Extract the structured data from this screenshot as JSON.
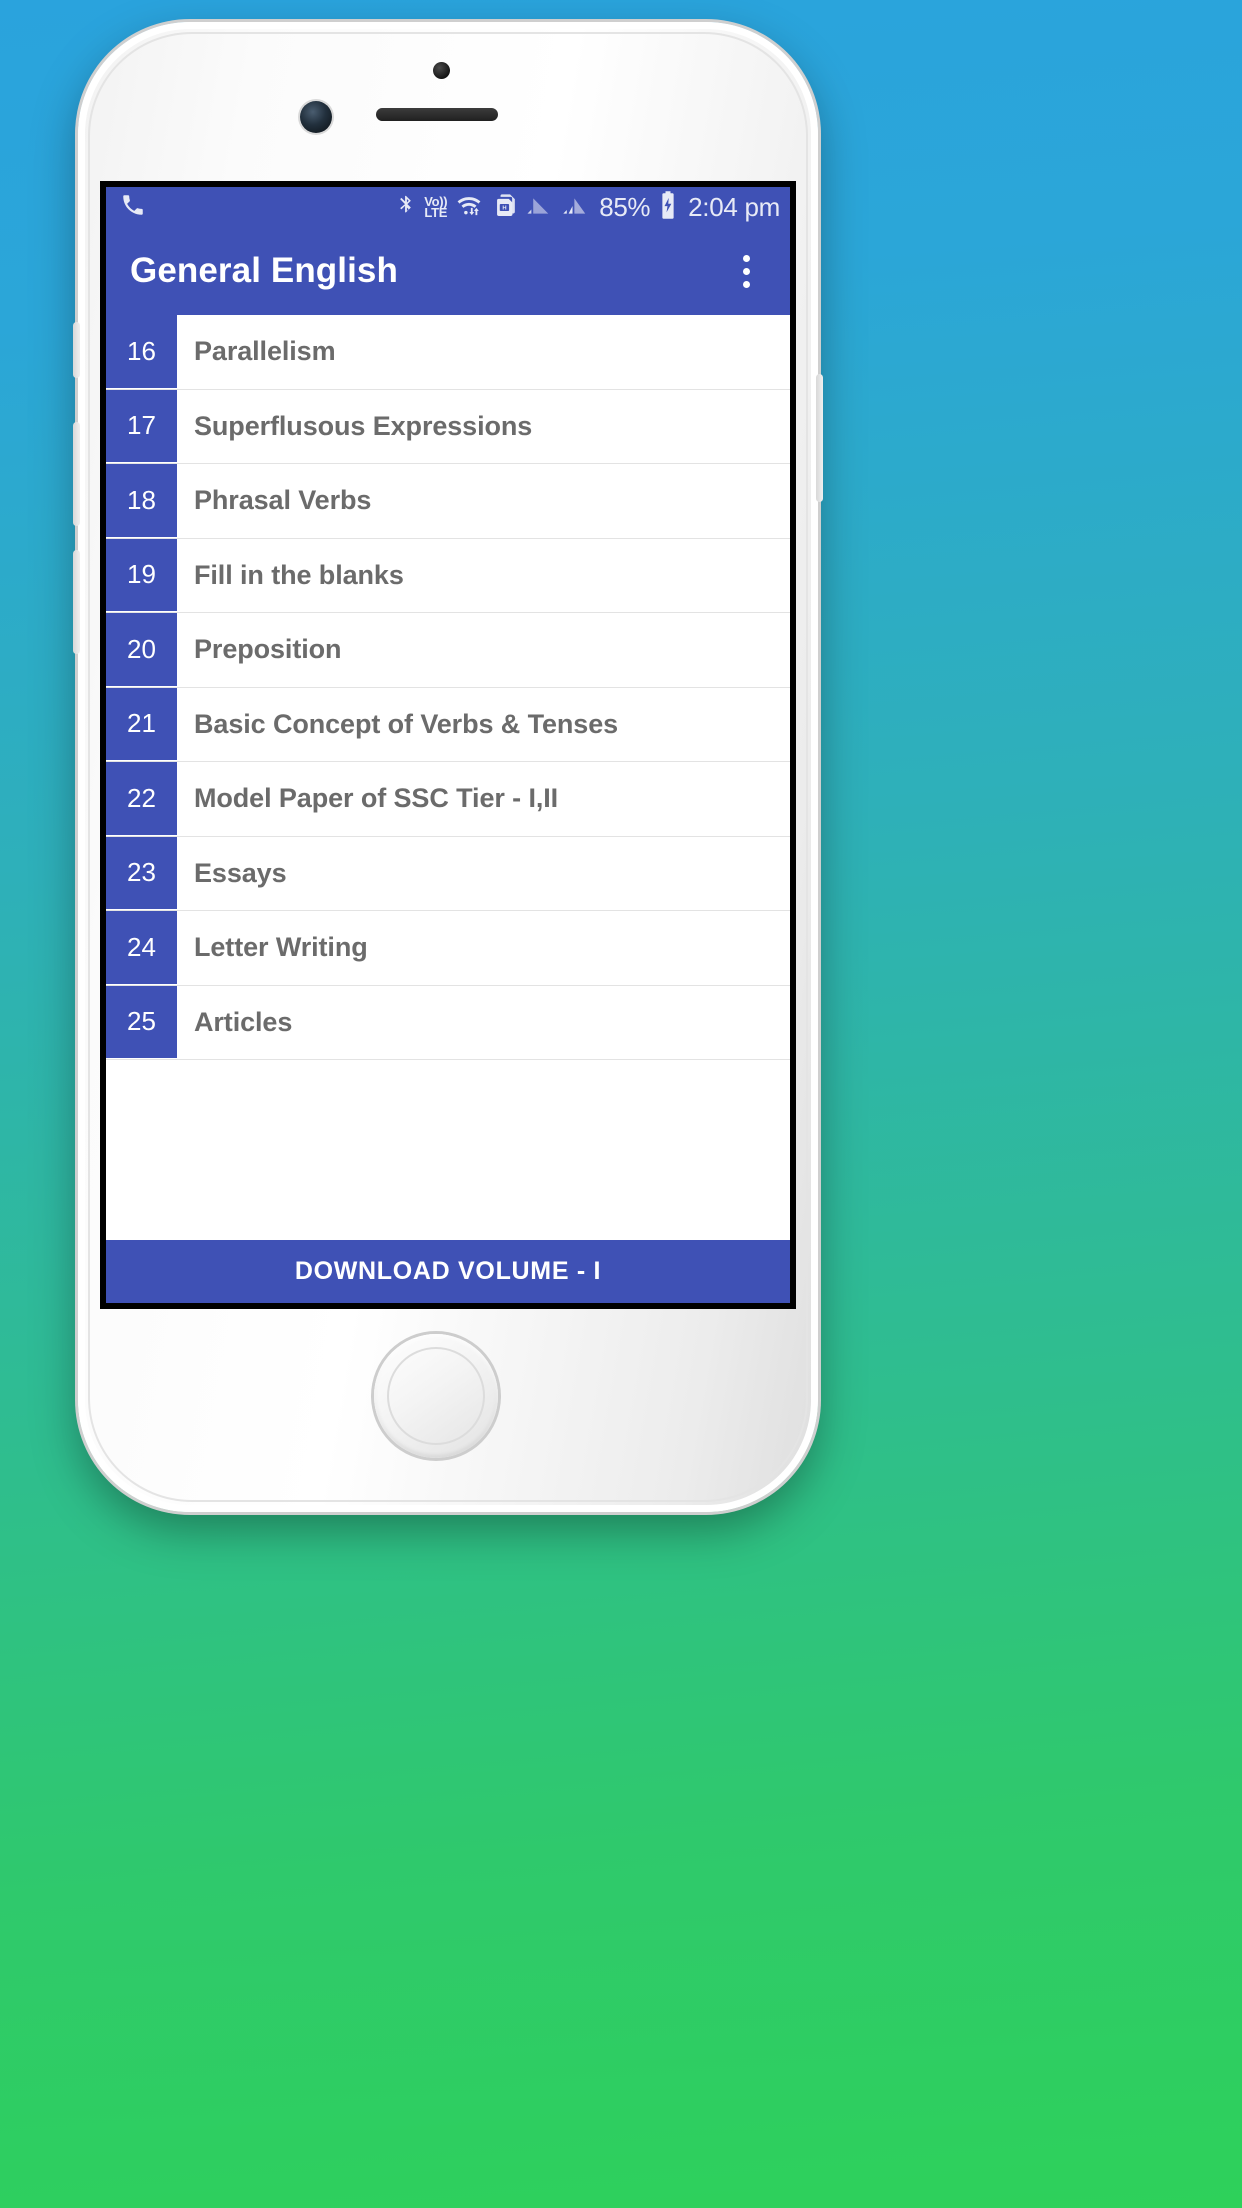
{
  "status_bar": {
    "phone_icon": "phone-handset-icon",
    "icons": [
      "bluetooth-icon",
      "volte-icon",
      "wifi-icon",
      "dual-sim-icon",
      "signal-sim1-icon",
      "signal-sim2-icon"
    ],
    "volte_top": "Vo))",
    "volte_bottom": "LTE",
    "battery_percent": "85%",
    "battery_icon": "battery-charging-icon",
    "time": "2:04 pm"
  },
  "app_bar": {
    "title": "General English",
    "overflow_icon": "overflow-menu-icon"
  },
  "list": {
    "rows": [
      {
        "num": "16",
        "title": "Parallelism"
      },
      {
        "num": "17",
        "title": "Superflusous Expressions"
      },
      {
        "num": "18",
        "title": "Phrasal Verbs"
      },
      {
        "num": "19",
        "title": "Fill in the blanks"
      },
      {
        "num": "20",
        "title": "Preposition"
      },
      {
        "num": "21",
        "title": "Basic Concept of Verbs & Tenses"
      },
      {
        "num": "22",
        "title": "Model Paper of SSC Tier - I,II"
      },
      {
        "num": "23",
        "title": "Essays"
      },
      {
        "num": "24",
        "title": "Letter Writing"
      },
      {
        "num": "25",
        "title": "Articles"
      }
    ]
  },
  "download_bar": {
    "label": "DOWNLOAD VOLUME - I"
  },
  "colors": {
    "primary": "#3f51b5",
    "row_text": "#6b6b6b",
    "screen_bg": "#ffffff",
    "backdrop_top": "#2aa3dd",
    "backdrop_bottom": "#2ed15a"
  }
}
